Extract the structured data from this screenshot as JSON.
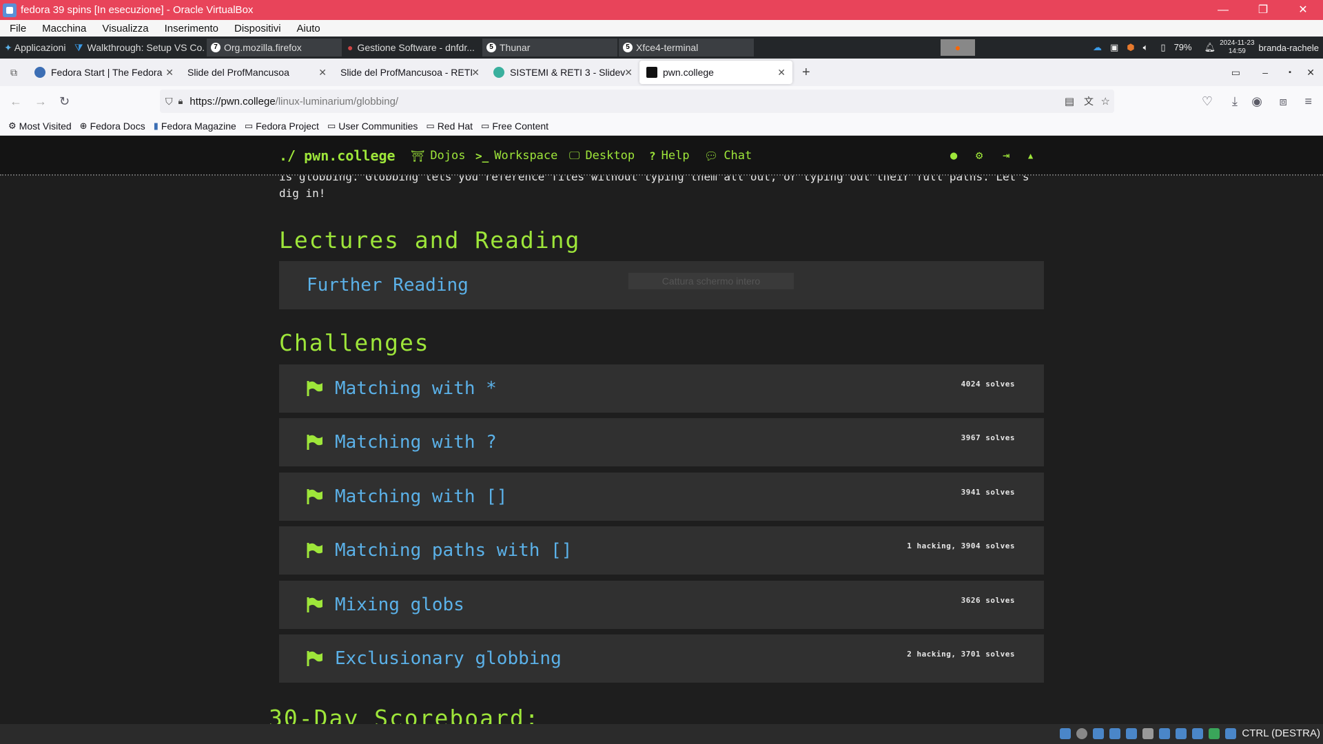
{
  "vbox": {
    "title": "fedora 39 spins [In esecuzione] - Oracle VirtualBox",
    "menu": [
      "File",
      "Macchina",
      "Visualizza",
      "Inserimento",
      "Dispositivi",
      "Aiuto"
    ],
    "win_controls": [
      "—",
      "❐",
      "✕"
    ]
  },
  "panel": {
    "apps_label": "Applicazioni",
    "tasks": [
      {
        "label": "Walkthrough: Setup VS Co...",
        "badge": ""
      },
      {
        "label": "Org.mozilla.firefox",
        "badge": "7"
      },
      {
        "label": "Gestione Software - dnfdr...",
        "badge": ""
      },
      {
        "label": "Thunar",
        "badge": "5"
      },
      {
        "label": "Xfce4-terminal",
        "badge": "5"
      }
    ],
    "battery": "79%",
    "date": "2024-11-23",
    "time": "14:59",
    "user": "branda-rachele"
  },
  "firefox": {
    "tabs": [
      {
        "label": "Fedora Start | The Fedora",
        "color": "#3c6eb4"
      },
      {
        "label": "Slide del ProfMancusoa",
        "color": ""
      },
      {
        "label": "Slide del ProfMancusoa - RETI",
        "color": ""
      },
      {
        "label": "SISTEMI & RETI 3 - Slidev",
        "color": "#3ab09e"
      },
      {
        "label": "pwn.college",
        "color": "#111111"
      }
    ],
    "url_host": "https://pwn.college",
    "url_path": "/linux-luminarium/globbing/",
    "bookmarks": [
      {
        "icon": "⚙",
        "label": "Most Visited"
      },
      {
        "icon": "⊕",
        "label": "Fedora Docs"
      },
      {
        "icon": "▮",
        "label": "Fedora Magazine"
      },
      {
        "icon": "▭",
        "label": "Fedora Project"
      },
      {
        "icon": "▭",
        "label": "User Communities"
      },
      {
        "icon": "▭",
        "label": "Red Hat"
      },
      {
        "icon": "▭",
        "label": "Free Content"
      }
    ]
  },
  "site": {
    "brand": "./ pwn.college",
    "nav": [
      "Dojos",
      "Workspace",
      "Desktop",
      "Help",
      "Chat"
    ],
    "intro_line1": "is globbing. Globbing lets you reference files without typing them all out, or typing out their full paths. Let's",
    "intro_line2": "dig in!",
    "lectures_heading": "Lectures and Reading",
    "further_reading": "Further Reading",
    "capture_overlay": "Cattura schermo intero",
    "challenges_heading": "Challenges",
    "challenges": [
      {
        "name": "Matching with *",
        "solves": "4024 solves"
      },
      {
        "name": "Matching with ?",
        "solves": "3967 solves"
      },
      {
        "name": "Matching with []",
        "solves": "3941 solves"
      },
      {
        "name": "Matching paths with []",
        "solves": "1 hacking, 3904 solves"
      },
      {
        "name": "Mixing globs",
        "solves": "3626 solves"
      },
      {
        "name": "Exclusionary globbing",
        "solves": "2 hacking, 3701 solves"
      }
    ],
    "scoreboard_heading": "30-Day Scoreboard:",
    "accent": "#9ee63a",
    "link_color": "#5bb1e8"
  },
  "taskbar": {
    "host_key": "CTRL (DESTRA)"
  }
}
